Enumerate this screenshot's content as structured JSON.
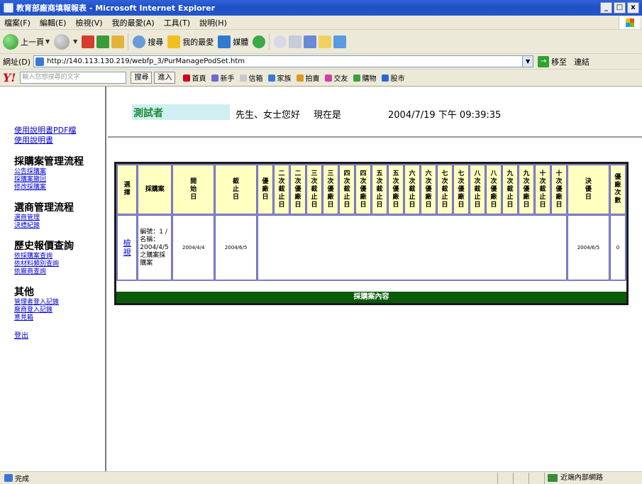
{
  "window": {
    "title": "教育部廠商填報報表 - Microsoft Internet Explorer",
    "minimize": "_",
    "maximize": "□",
    "close": "x"
  },
  "menu": [
    "檔案(F)",
    "編輯(E)",
    "檢視(V)",
    "我的最愛(A)",
    "工具(T)",
    "說明(H)"
  ],
  "toolbar": {
    "back": "上一頁",
    "search": "搜尋",
    "favorites": "我的最愛",
    "media": "媒體"
  },
  "address": {
    "label": "網址(D)",
    "url": "http://140.113.130.219/webfp_3/PurManagePodSet.htm",
    "go": "移至",
    "links": "連結"
  },
  "yahoo": {
    "logo": "Y!",
    "search_placeholder": "輸入您想搜尋的文字",
    "search_btn": "搜尋",
    "enter_btn": "進入",
    "links": [
      "首頁",
      "新手",
      "信箱",
      "家族",
      "拍賣",
      "交友",
      "購物",
      "股市"
    ]
  },
  "sidebar": {
    "manual_pdf": "使用說明書PDF檔",
    "manual": "使用說明書",
    "sections": [
      {
        "title": "採購案管理流程",
        "items": [
          "公告採購案",
          "採購案撤回",
          "修改採購案"
        ]
      },
      {
        "title": "選商管理流程",
        "items": [
          "選商管理",
          "決標紀錄"
        ]
      },
      {
        "title": "歷史報價查詢",
        "items": [
          "依採購案查詢",
          "依材料類別查詢",
          "依廠商查詢"
        ]
      },
      {
        "title": "其他",
        "items": [
          "管理者登入記錄",
          "廠商登入記錄",
          "意見箱"
        ]
      }
    ],
    "logout": "登出"
  },
  "header": {
    "user": "測試者",
    "greeting": "先生、女士您好",
    "now_label": "現在是",
    "now_time": "2004/7/19 下午 09:39:35"
  },
  "table": {
    "headers": [
      "選擇",
      "採購案",
      "開始日",
      "截止日",
      "優廠日",
      "二次截止日",
      "二次優廠日",
      "三次截止日",
      "三次優廠日",
      "四次截止日",
      "四次優廠日",
      "五次截止日",
      "五次優廠日",
      "六次截止日",
      "六次優廠日",
      "七次截止日",
      "七次優廠日",
      "八次截止日",
      "八次優廠日",
      "九次截止日",
      "九次優廠日",
      "十次截止日",
      "十次優廠日",
      "決優日",
      "優廠次數"
    ],
    "row": {
      "view": "檢視",
      "case": "編號：1 /名稱：2004/4/5之購案採購案",
      "start": "2004/4/4",
      "deadline": "2004/6/5",
      "decided": "2004/6/5",
      "count": "0"
    },
    "footer": "採購案內容"
  },
  "status": {
    "text": "完成",
    "zone": "近端內部網路"
  }
}
